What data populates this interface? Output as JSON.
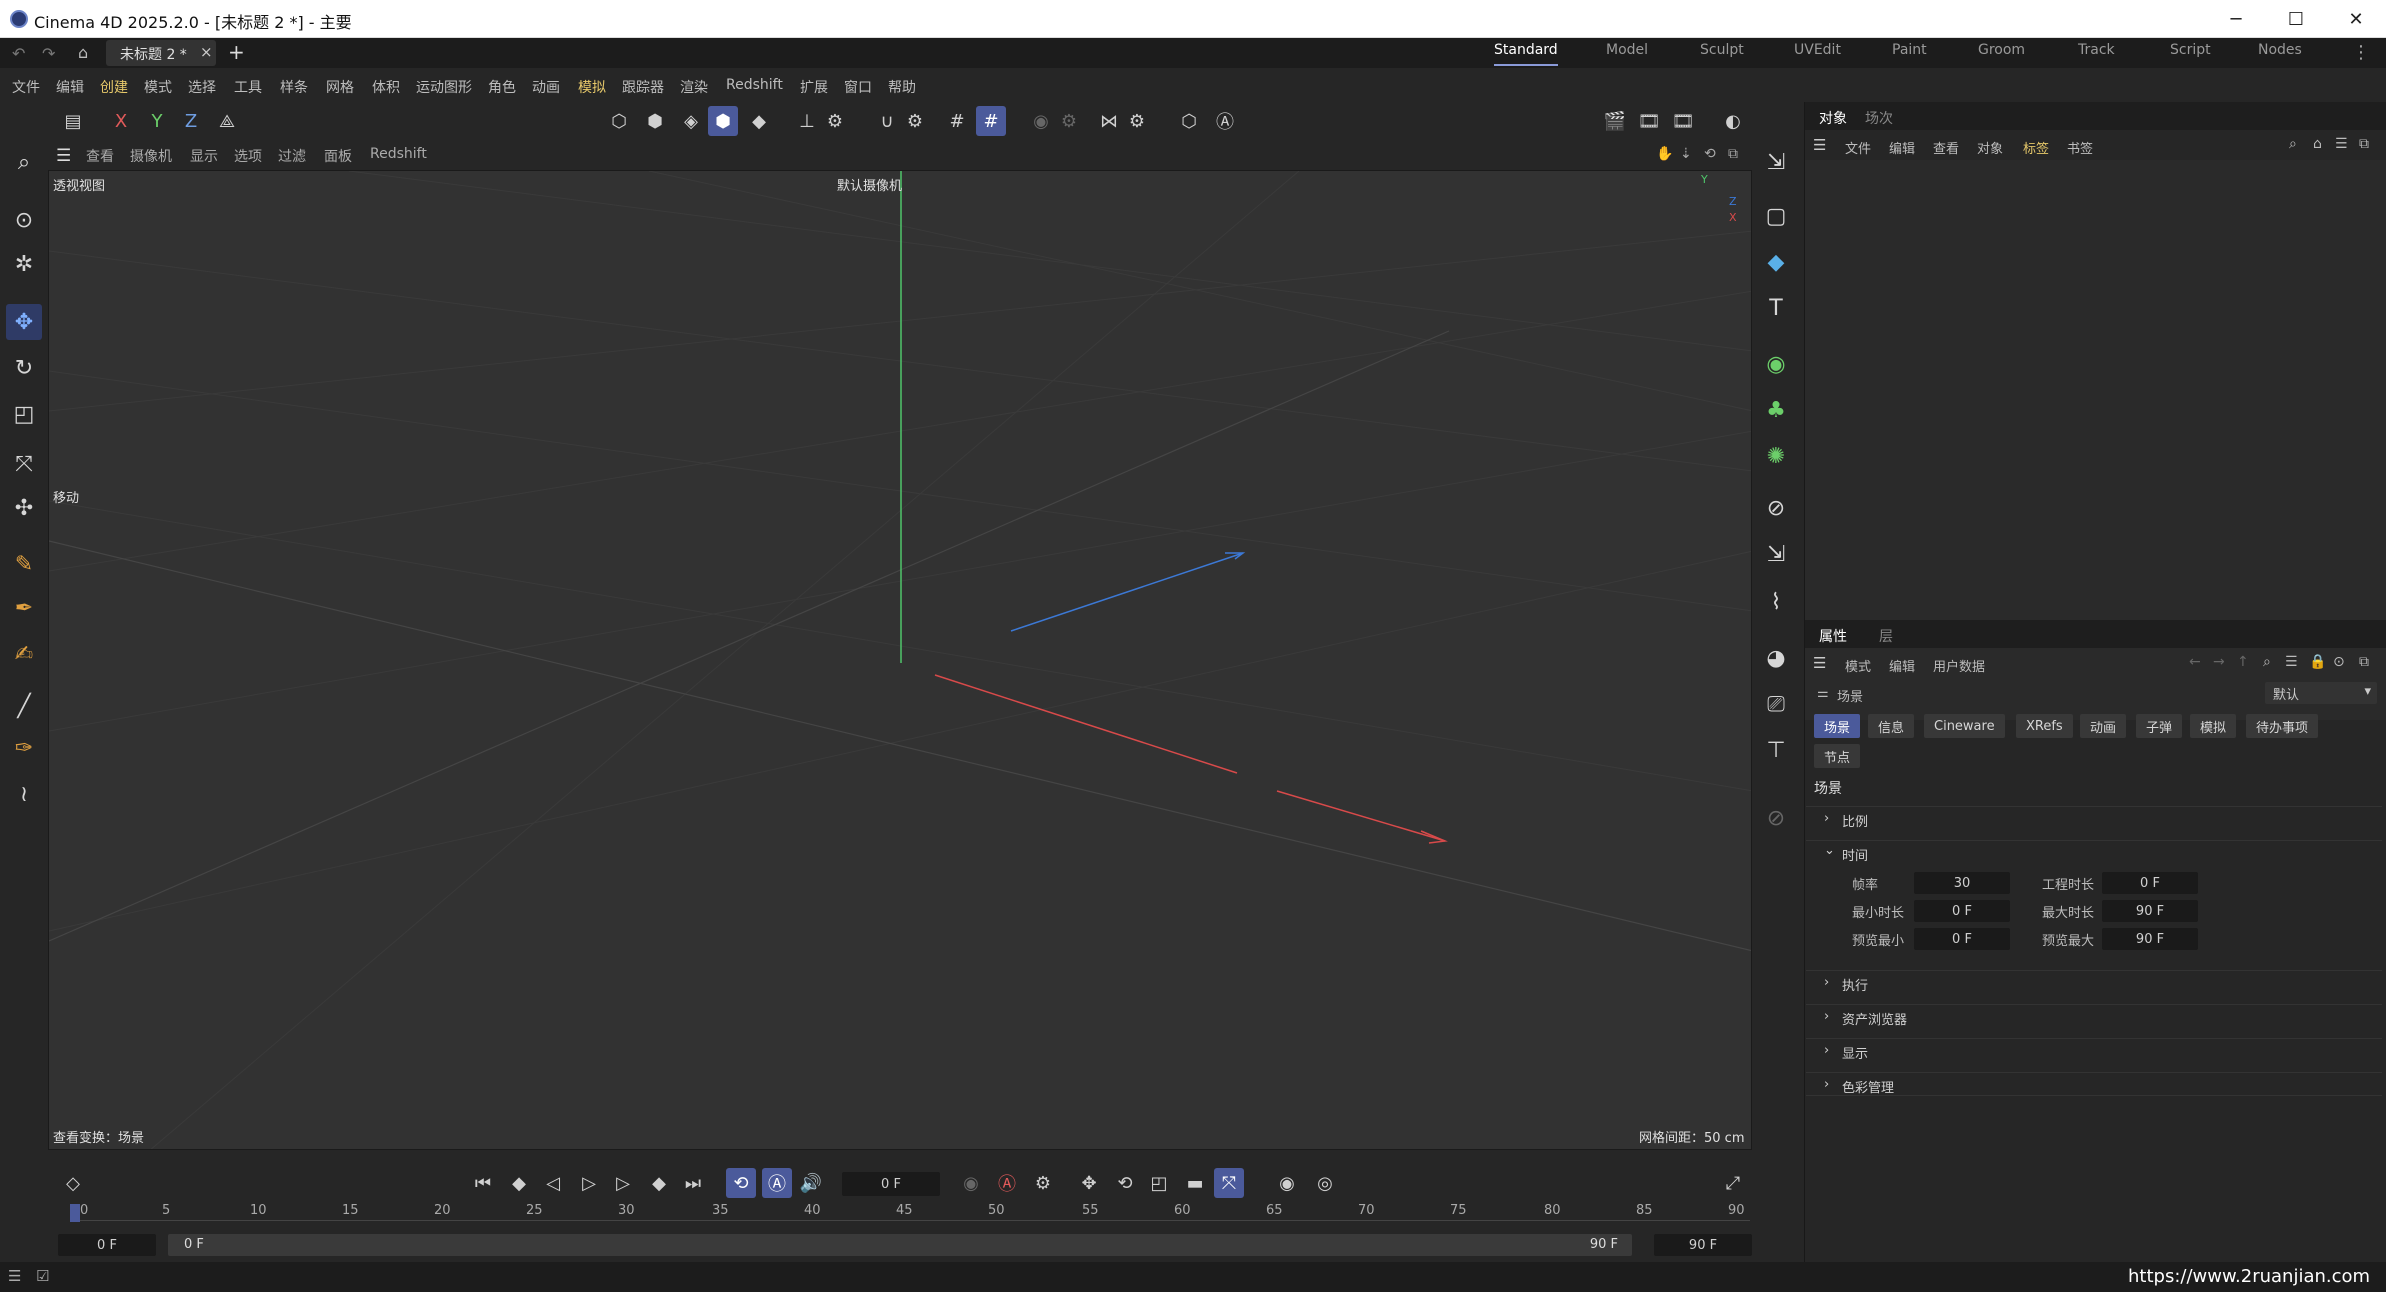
{
  "window": {
    "title": "Cinema 4D 2025.2.0 - [未标题 2 *] - 主要",
    "min": "─",
    "max": "☐",
    "close": "✕"
  },
  "tabs": {
    "doc": "未标题 2 *",
    "close": "×",
    "add": "+"
  },
  "layouts": [
    "Standard",
    "Model",
    "Sculpt",
    "UVEdit",
    "Paint",
    "Groom",
    "Track",
    "Script",
    "Nodes"
  ],
  "menu": [
    "文件",
    "编辑",
    "创建",
    "模式",
    "选择",
    "工具",
    "样条",
    "网格",
    "体积",
    "运动图形",
    "角色",
    "动画",
    "模拟",
    "跟踪器",
    "渲染",
    "Redshift",
    "扩展",
    "窗口",
    "帮助"
  ],
  "axes": {
    "x": "X",
    "y": "Y",
    "z": "Z"
  },
  "viewport": {
    "menu": [
      "查看",
      "摄像机",
      "显示",
      "选项",
      "过滤",
      "面板",
      "Redshift"
    ],
    "name": "透视视图",
    "camera": "默认摄像机",
    "tool": "移动",
    "transform": "查看变换：场景",
    "grid": "网格间距：50 cm",
    "gizmo": {
      "y": "Y",
      "z": "Z",
      "x": "X"
    }
  },
  "objects": {
    "tabs": [
      "对象",
      "场次"
    ],
    "menu": [
      "文件",
      "编辑",
      "查看",
      "对象",
      "标签",
      "书签"
    ]
  },
  "attributes": {
    "tabs": [
      "属性",
      "层"
    ],
    "menu": [
      "模式",
      "编辑",
      "用户数据"
    ],
    "type": "场景",
    "preset": "默认",
    "chips_row1": [
      "场景",
      "信息",
      "Cineware",
      "XRefs",
      "动画",
      "子弹",
      "模拟",
      "待办事项"
    ],
    "chips_row2": [
      "节点"
    ],
    "heading": "场景",
    "sections": {
      "scale": "比例",
      "time": "时间",
      "exec": "执行",
      "asset": "资产浏览器",
      "display": "显示",
      "color": "色彩管理"
    },
    "time": {
      "fps_label": "帧率",
      "fps": "30",
      "proj_label": "工程时长",
      "proj": "0 F",
      "min_label": "最小时长",
      "min": "0 F",
      "max_label": "最大时长",
      "max": "90 F",
      "pmin_label": "预览最小",
      "pmin": "0 F",
      "pmax_label": "预览最大",
      "pmax": "90 F"
    }
  },
  "timeline": {
    "current": "0 F",
    "ticks": [
      "0",
      "5",
      "10",
      "15",
      "20",
      "25",
      "30",
      "35",
      "40",
      "45",
      "50",
      "55",
      "60",
      "65",
      "70",
      "75",
      "80",
      "85",
      "90"
    ],
    "range_start": "0 F",
    "range_start2": "0 F",
    "range_end": "90 F",
    "range_end2": "90 F"
  },
  "status": {
    "url": "https://www.2ruanjian.com"
  },
  "colors": {
    "accent": "#4b5a9b",
    "xaxis": "#d84a4a",
    "yaxis": "#4fc56a",
    "zaxis": "#3c79d6"
  }
}
